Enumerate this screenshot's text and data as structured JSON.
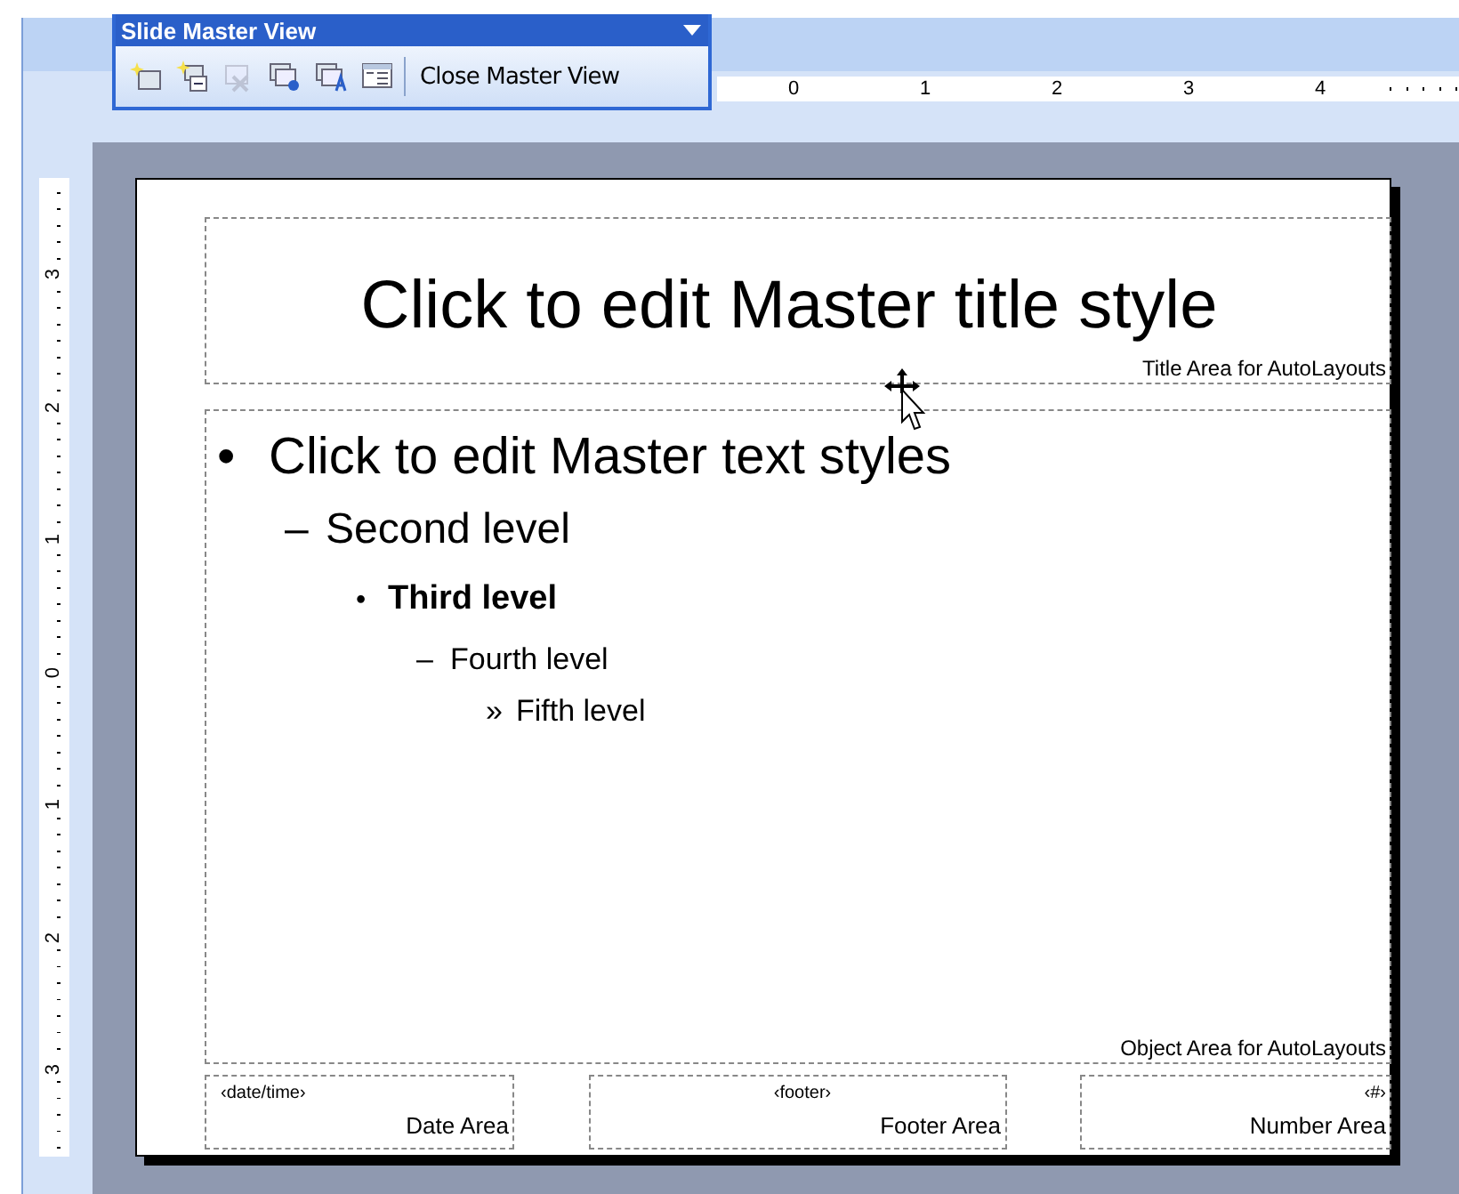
{
  "toolbar": {
    "title": "Slide Master View",
    "tools": [
      {
        "kind": "new-master",
        "disabled": false
      },
      {
        "kind": "new-title-master",
        "disabled": false
      },
      {
        "kind": "delete-master",
        "disabled": true
      },
      {
        "kind": "preserve-master",
        "disabled": false
      },
      {
        "kind": "rename-master",
        "disabled": false
      },
      {
        "kind": "master-layout",
        "disabled": false
      }
    ],
    "close_label": "Close Master View"
  },
  "horizontal_ruler": [
    "0",
    "1",
    "2",
    "3",
    "4"
  ],
  "vertical_ruler": [
    "3",
    "2",
    "1",
    "0",
    "1",
    "2",
    "3"
  ],
  "slide": {
    "title_placeholder": {
      "text": "Click to edit Master title style",
      "label": "Title Area for AutoLayouts"
    },
    "object_placeholder": {
      "label": "Object Area for AutoLayouts",
      "levels": [
        {
          "bullet": "•",
          "text": "Click to edit Master text styles",
          "children": [
            {
              "bullet": "–",
              "text": "Second level",
              "children": [
                {
                  "bullet": "•",
                  "text": "Third level",
                  "children": [
                    {
                      "bullet": "–",
                      "text": "Fourth level",
                      "children": [
                        {
                          "bullet": "»",
                          "text": "Fifth level"
                        }
                      ]
                    }
                  ]
                }
              ]
            }
          ]
        }
      ]
    },
    "footer_areas": [
      {
        "kind": "date",
        "field": "‹date/time›",
        "label": "Date Area"
      },
      {
        "kind": "footer",
        "field": "‹footer›",
        "label": "Footer Area"
      },
      {
        "kind": "number",
        "field": "‹#›",
        "label": "Number Area"
      }
    ]
  }
}
